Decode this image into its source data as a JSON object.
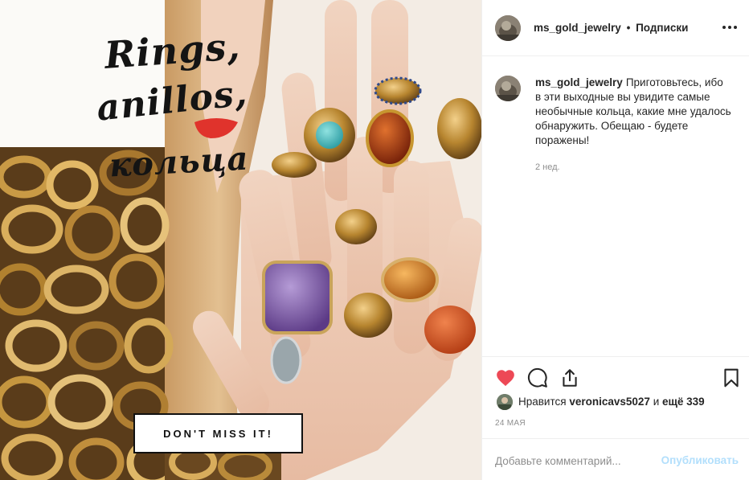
{
  "post": {
    "image": {
      "title_lines": [
        "Rings,",
        "anillos,",
        "кольца"
      ],
      "cta_label": "DON'T MISS IT!"
    },
    "header": {
      "username": "ms_gold_jewelry",
      "separator": "•",
      "follow_status": "Подписки",
      "more_icon": "more-horizontal-icon"
    },
    "caption": {
      "username": "ms_gold_jewelry",
      "text": "Приготовьтесь, ибо в эти выходные вы увидите самые необычные кольца, какие мне удалось обнаружить. Обещаю - будете поражены!",
      "time": "2 нед."
    },
    "actions": {
      "like_icon": "heart-icon",
      "comment_icon": "comment-icon",
      "share_icon": "share-icon",
      "save_icon": "bookmark-icon",
      "liked": true,
      "like_color": "#ed4956"
    },
    "likes": {
      "prefix": "Нравится",
      "user": "veronicavs5027",
      "middle": "и",
      "others": "ещё 339"
    },
    "date": "24 мая",
    "comment": {
      "placeholder": "Добавьте комментарий...",
      "publish_label": "Опубликовать"
    }
  }
}
